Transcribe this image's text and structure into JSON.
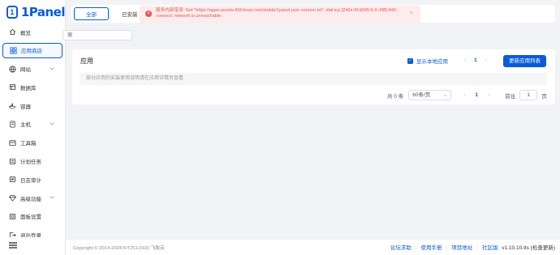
{
  "app": {
    "logo_text": "1Panel",
    "logo_mark": "1"
  },
  "sidebar": {
    "items": [
      {
        "label": "概览",
        "icon": "home-icon",
        "active": false,
        "chevron": false
      },
      {
        "label": "应用商店",
        "icon": "grid-icon",
        "active": true,
        "chevron": false
      },
      {
        "label": "网站",
        "icon": "globe-icon",
        "active": false,
        "chevron": true
      },
      {
        "label": "数据库",
        "icon": "database-icon",
        "active": false,
        "chevron": false
      },
      {
        "label": "容器",
        "icon": "container-icon",
        "active": false,
        "chevron": false
      },
      {
        "label": "主机",
        "icon": "server-icon",
        "active": false,
        "chevron": true
      },
      {
        "label": "工具箱",
        "icon": "toolbox-icon",
        "active": false,
        "chevron": false
      },
      {
        "label": "计划任务",
        "icon": "calendar-icon",
        "active": false,
        "chevron": false
      },
      {
        "label": "日志审计",
        "icon": "log-icon",
        "active": false,
        "chevron": false
      },
      {
        "label": "高级功能",
        "icon": "diamond-icon",
        "active": false,
        "chevron": true
      },
      {
        "label": "面板设置",
        "icon": "settings-icon",
        "active": false,
        "chevron": false
      },
      {
        "label": "退出登录",
        "icon": "logout-icon",
        "active": false,
        "chevron": false
      }
    ],
    "menu_icon": "hamburger-icon"
  },
  "tabs": {
    "all": "全部",
    "installed": "已安装"
  },
  "alert": {
    "message": "服务内部错误: Get \"https://apps-assets.fit2cloud.com/stable/1panel.json.version.txt\": dial tcp [240e:9f:d005:6:3::3f8]:443: connect: network is unreachable",
    "close": "×",
    "err_icon": "×"
  },
  "search": {
    "placeholder": "索"
  },
  "card": {
    "title": "应用",
    "show_local_label": "显示本地应用",
    "show_local_checked": true,
    "check_mark": "✓",
    "refresh_label": "更新应用列表",
    "notice": "部分应用的安装使用说明请在应用详情页查看",
    "mini_pager": {
      "prev": "‹",
      "current": "1",
      "next": "›"
    }
  },
  "pager": {
    "total": "共 0 条",
    "page_size": "60条/页",
    "dropdown": "⌄",
    "prev": "‹",
    "current": "1",
    "next": "›",
    "goto_label": "前往",
    "goto_value": "1",
    "page_unit": "页"
  },
  "footer": {
    "copyright": "Copyright © 2014-2024 FIT2CLOUD 飞致云",
    "links": [
      "论坛求助",
      "使用手册",
      "项目地址",
      "社区版:"
    ],
    "version": "v1.10.10-lts (检查更新)"
  },
  "colors": {
    "brand": "#0a5bd7",
    "error": "#e65757",
    "error_bg": "#fdecec"
  }
}
